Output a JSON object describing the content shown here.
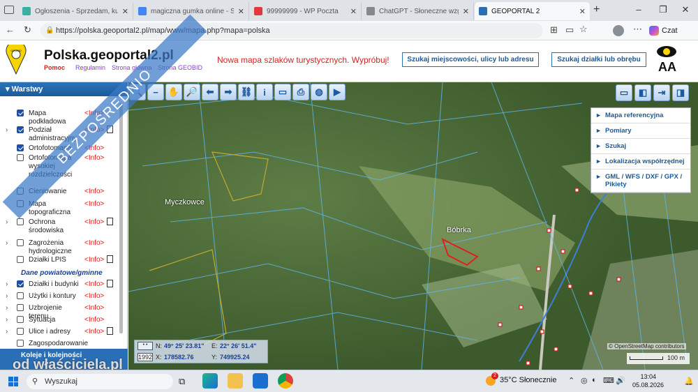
{
  "browser": {
    "tabs": [
      {
        "label": "Ogłoszenia - Sprzedam, kupię",
        "favicon_color": "#3ab0a0"
      },
      {
        "label": "magiczna gumka online - Szuk",
        "favicon_color": "#4285f4"
      },
      {
        "label": "99999999 - WP Poczta",
        "favicon_color": "#e23b3b"
      },
      {
        "label": "ChatGPT - Słoneczne wzgórze",
        "favicon_color": "#888888"
      },
      {
        "label": "GEOPORTAL 2",
        "favicon_color": "#2a6fb5",
        "active": true
      }
    ],
    "url": "https://polska.geoportal2.pl/map/www/mapa.php?mapa=polska",
    "copilot_label": "Czat"
  },
  "header": {
    "brand": "Polska.geoportal2.pl",
    "links": [
      "Pomoc",
      "Regulamin",
      "Strona główna",
      "Strona GEOBID"
    ],
    "promo": "Nowa mapa szlaków turystycznych. Wypróbuj!",
    "search_address_button": "Szukaj miejscowości, ulicy lub adresu",
    "search_parcel_button": "Szukaj działki lub obrębu",
    "font_size_label": "AA",
    "logo_text": "GEOBID"
  },
  "sidebar": {
    "title": "Warstwy",
    "layers": [
      {
        "name": "Mapa podkładowa",
        "info": "<Info>",
        "checked": true,
        "expand": false,
        "doc": false
      },
      {
        "name": "Podział administracyjny",
        "info": "<Info>",
        "checked": true,
        "expand": true,
        "doc": true
      },
      {
        "name": "Ortofotomapa",
        "info": "<Info>",
        "checked": true,
        "expand": false,
        "doc": false
      },
      {
        "name": "Ortofotomapa wysokiej rozdzielczości",
        "info": "<Info>",
        "checked": false,
        "expand": false,
        "doc": false
      },
      {
        "name": "Cieniowanie",
        "info": "<Info>",
        "checked": false,
        "expand": false,
        "doc": false
      },
      {
        "name": "Mapa topograficzna",
        "info": "<Info>",
        "checked": false,
        "expand": false,
        "doc": false
      },
      {
        "name": "Ochrona środowiska",
        "info": "<Info>",
        "checked": false,
        "expand": true,
        "doc": true
      },
      {
        "name": "Zagrożenia hydrologiczne",
        "info": "<Info>",
        "checked": false,
        "expand": true,
        "doc": false
      },
      {
        "name": "Działki LPIS",
        "info": "<Info>",
        "checked": false,
        "expand": false,
        "doc": true
      }
    ],
    "group_label": "Dane powiatowe/gminne",
    "layers2": [
      {
        "name": "Działki i budynki",
        "info": "<Info>",
        "checked": true,
        "expand": true,
        "doc": true
      },
      {
        "name": "Użytki i kontury",
        "info": "<Info>",
        "checked": false,
        "expand": true,
        "doc": false
      },
      {
        "name": "Uzbrojenie terenu",
        "info": "<Info>",
        "checked": false,
        "expand": true,
        "doc": false
      },
      {
        "name": "Sytuacja",
        "info": "<Info>",
        "checked": false,
        "expand": true,
        "doc": false
      },
      {
        "name": "Ulice i adresy",
        "info": "<Info>",
        "checked": false,
        "expand": true,
        "doc": true
      },
      {
        "name": "Zagospodarowanie",
        "info": "",
        "checked": false,
        "expand": false,
        "doc": false
      }
    ],
    "footer_label": "Koleje i kolejności"
  },
  "map": {
    "labels": [
      "Myczkowce",
      "Bóbrka"
    ],
    "menu": [
      "Mapa referencyjna",
      "Pomiary",
      "Szukaj",
      "Lokalizacja współrzędnej",
      "GML / WFS / DXF / GPX / Pikiety"
    ],
    "coords": {
      "n_label": "N:",
      "n_value": "49° 25' 23.81\"",
      "e_label": "E:",
      "e_value": "22° 26' 51.4\"",
      "x_label": "X:",
      "x_value": "178582.76",
      "y_label": "Y:",
      "y_value": "749925.24",
      "system": "1992"
    },
    "scale": "100 m",
    "attribution": "© OpenStreetMap contributors"
  },
  "overlay": {
    "ribbon": "BEZPOŚREDNIO",
    "watermark": "od właściciela.pl"
  },
  "taskbar": {
    "search_placeholder": "Wyszukaj",
    "weather_temp": "35°C",
    "weather_desc": "Słonecznie",
    "time": "13:04",
    "date": "05.08.2026",
    "weather_badge": "2"
  }
}
